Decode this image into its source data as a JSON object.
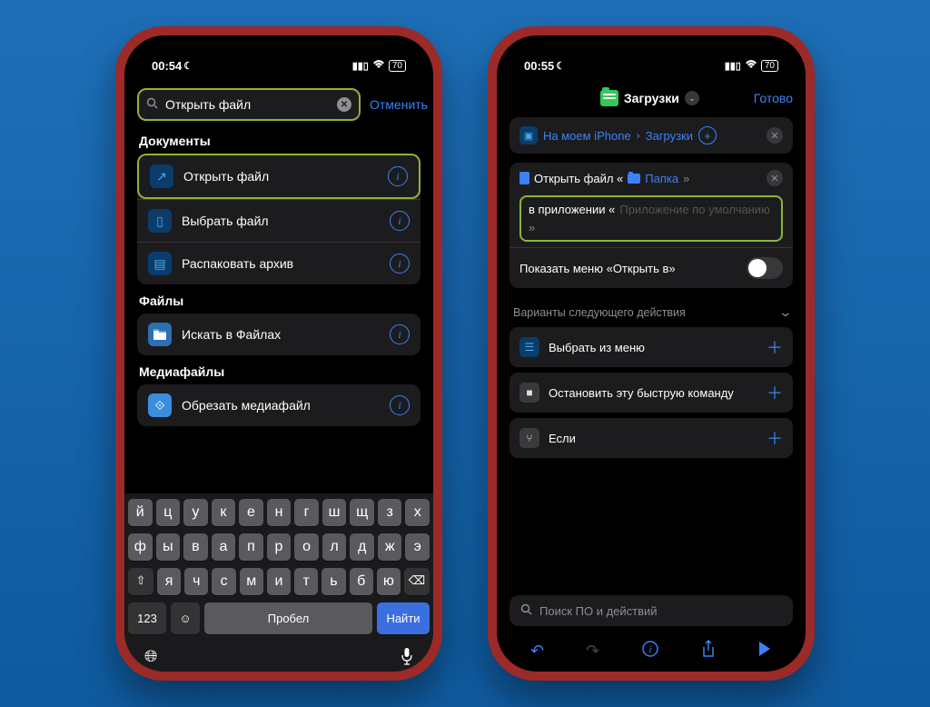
{
  "phone1": {
    "status": {
      "time": "00:54",
      "battery": "70"
    },
    "search": {
      "value": "Открыть файл",
      "cancel": "Отменить"
    },
    "sections": {
      "documents": {
        "title": "Документы",
        "items": [
          {
            "label": "Открыть файл"
          },
          {
            "label": "Выбрать файл"
          },
          {
            "label": "Распаковать архив"
          }
        ]
      },
      "files": {
        "title": "Файлы",
        "items": [
          {
            "label": "Искать в Файлах"
          }
        ]
      },
      "media": {
        "title": "Медиафайлы",
        "items": [
          {
            "label": "Обрезать медиафайл"
          }
        ]
      }
    },
    "keyboard": {
      "row1": [
        "й",
        "ц",
        "у",
        "к",
        "е",
        "н",
        "г",
        "ш",
        "щ",
        "з",
        "х"
      ],
      "row2": [
        "ф",
        "ы",
        "в",
        "а",
        "п",
        "р",
        "о",
        "л",
        "д",
        "ж",
        "э"
      ],
      "row3": [
        "я",
        "ч",
        "с",
        "м",
        "и",
        "т",
        "ь",
        "б",
        "ю"
      ],
      "num": "123",
      "space": "Пробел",
      "find": "Найти"
    }
  },
  "phone2": {
    "status": {
      "time": "00:55",
      "battery": "70"
    },
    "header": {
      "title": "Загрузки",
      "done": "Готово"
    },
    "breadcrumb": {
      "loc1": "На моем iPhone",
      "loc2": "Загрузки"
    },
    "action": {
      "line1_pre": "Открыть файл «",
      "line1_param": "Папка",
      "line1_post": "»",
      "line2_pre": "в приложении «",
      "line2_param": "Приложение по умолчанию",
      "line2_post": "»",
      "toggle_label": "Показать меню «Открыть в»"
    },
    "next": {
      "header": "Варианты следующего действия",
      "items": [
        {
          "label": "Выбрать из меню"
        },
        {
          "label": "Остановить эту быструю команду"
        },
        {
          "label": "Если"
        }
      ]
    },
    "footer_search": "Поиск ПО и действий"
  }
}
